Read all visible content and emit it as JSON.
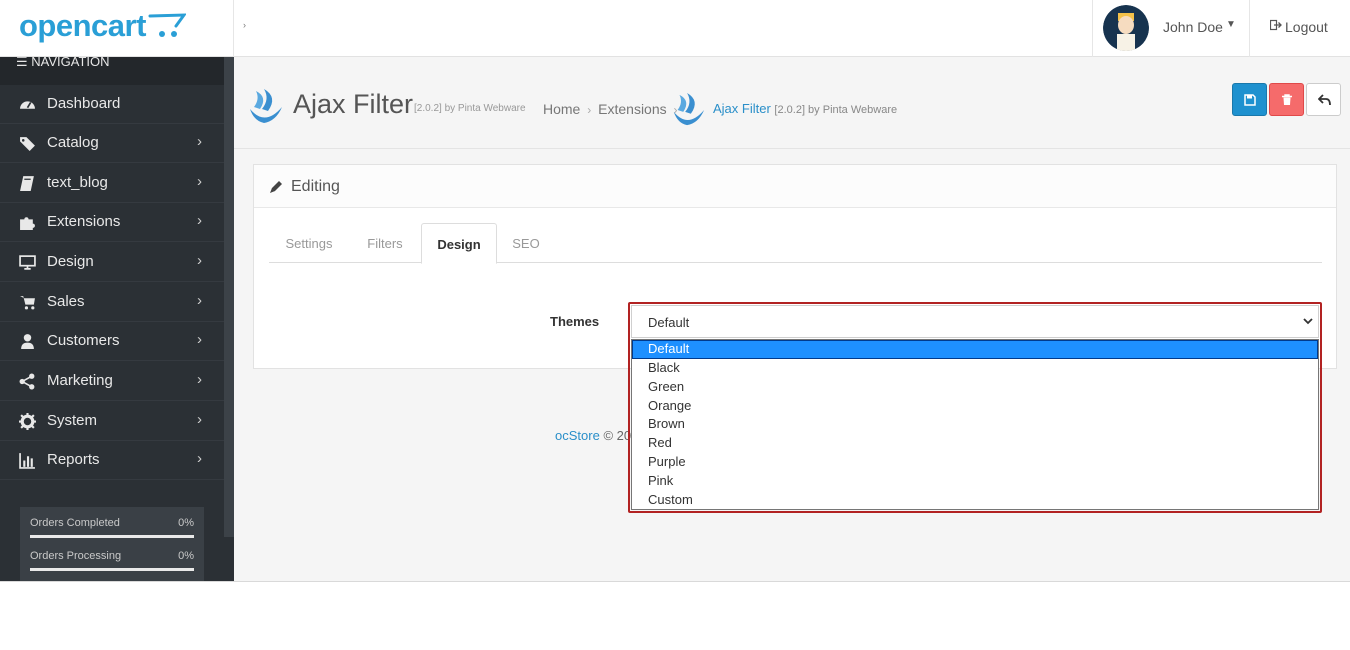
{
  "header": {
    "logo_text": "opencart",
    "sidebar_toggle": "›",
    "user_name": "John Doe",
    "logout_label": "Logout"
  },
  "sidebar": {
    "heading": "NAVIGATION",
    "items": [
      {
        "label": "Dashboard",
        "icon": "dashboard-icon",
        "has_children": false
      },
      {
        "label": "Catalog",
        "icon": "tags-icon",
        "has_children": true
      },
      {
        "label": "text_blog",
        "icon": "book-icon",
        "has_children": true
      },
      {
        "label": "Extensions",
        "icon": "puzzle-icon",
        "has_children": true
      },
      {
        "label": "Design",
        "icon": "monitor-icon",
        "has_children": true
      },
      {
        "label": "Sales",
        "icon": "cart-icon",
        "has_children": true
      },
      {
        "label": "Customers",
        "icon": "user-icon",
        "has_children": true
      },
      {
        "label": "Marketing",
        "icon": "share-icon",
        "has_children": true
      },
      {
        "label": "System",
        "icon": "cog-icon",
        "has_children": true
      },
      {
        "label": "Reports",
        "icon": "bar-chart-icon",
        "has_children": true
      }
    ],
    "stats": [
      {
        "label": "Orders Completed",
        "percent": "0%",
        "value": 0
      },
      {
        "label": "Orders Processing",
        "percent": "0%",
        "value": 0
      }
    ]
  },
  "page": {
    "title": "Ajax Filter",
    "version_meta": "[2.0.2] by Pinta Webware",
    "breadcrumb": [
      "Home",
      "Extensions"
    ],
    "breadcrumb_active": "Ajax Filter",
    "breadcrumb_active_meta": "[2.0.2] by Pinta Webware"
  },
  "panel": {
    "title": "Editing",
    "tabs": [
      {
        "label": "Settings",
        "active": false
      },
      {
        "label": "Filters",
        "active": false
      },
      {
        "label": "Design",
        "active": true
      },
      {
        "label": "SEO",
        "active": false
      }
    ],
    "themes_label": "Themes",
    "themes_value": "Default",
    "themes_options": [
      "Default",
      "Black",
      "Green",
      "Orange",
      "Brown",
      "Red",
      "Purple",
      "Pink",
      "Custom"
    ]
  },
  "footer": {
    "brand": "ocStore",
    "text": "© 20"
  },
  "colors": {
    "brand": "#2a9fd6",
    "sidebar_bg": "#2b3035",
    "save": "#1e91cf",
    "delete": "#f56b6b",
    "highlight": "#b22222",
    "option_selected": "#1e90ff"
  }
}
